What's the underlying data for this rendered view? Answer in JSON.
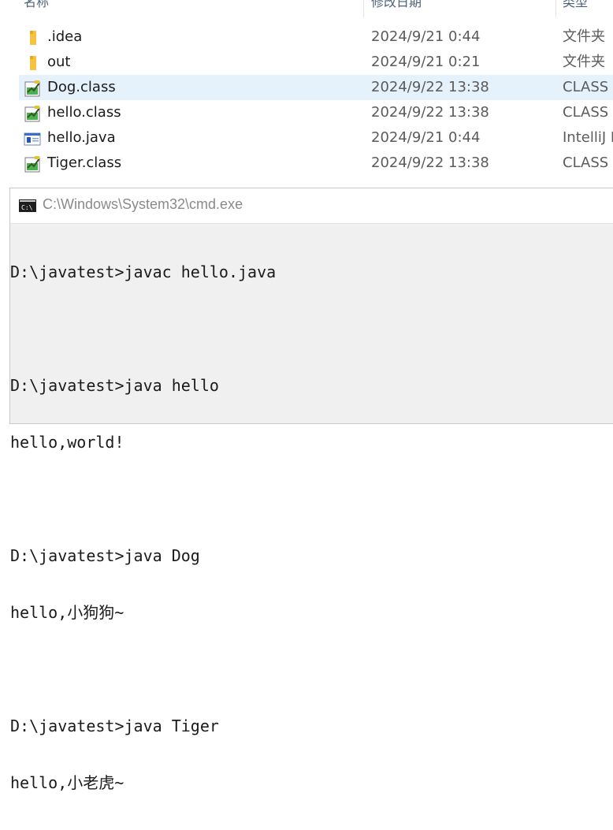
{
  "explorer": {
    "columns": {
      "name": "名称",
      "date": "修改日期",
      "type": "类型"
    },
    "files": [
      {
        "name": ".idea",
        "date": "2024/9/21 0:44",
        "type": "文件夹",
        "icon": "folder-icon"
      },
      {
        "name": "out",
        "date": "2024/9/21 0:21",
        "type": "文件夹",
        "icon": "folder-icon"
      },
      {
        "name": "Dog.class",
        "date": "2024/9/22 13:38",
        "type": "CLASS 文",
        "icon": "class-file-icon",
        "selected": true
      },
      {
        "name": "hello.class",
        "date": "2024/9/22 13:38",
        "type": "CLASS 文",
        "icon": "class-file-icon"
      },
      {
        "name": "hello.java",
        "date": "2024/9/21 0:44",
        "type": "IntelliJ I",
        "icon": "java-file-icon"
      },
      {
        "name": "Tiger.class",
        "date": "2024/9/22 13:38",
        "type": "CLASS 文",
        "icon": "class-file-icon"
      }
    ]
  },
  "cmd": {
    "title": "C:\\Windows\\System32\\cmd.exe",
    "icon": "cmd-icon",
    "lines": [
      "D:\\javatest>javac hello.java",
      "",
      "D:\\javatest>java hello",
      "hello,world!",
      "",
      "D:\\javatest>java Dog",
      "hello,小狗狗~",
      "",
      "D:\\javatest>java Tiger",
      "hello,小老虎~"
    ]
  },
  "colors": {
    "selection": "#e5f1fb",
    "folder": "#f5c342",
    "console_bg": "#f0f0f0"
  }
}
